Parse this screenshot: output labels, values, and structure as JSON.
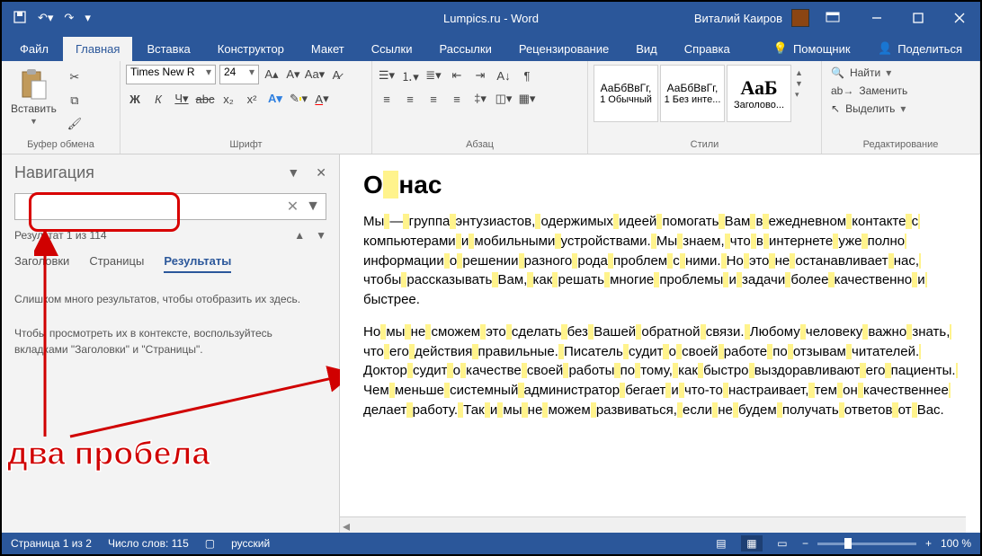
{
  "titlebar": {
    "title": "Lumpics.ru - Word",
    "user": "Виталий Каиров"
  },
  "tabs": {
    "items": [
      "Файл",
      "Главная",
      "Вставка",
      "Конструктор",
      "Макет",
      "Ссылки",
      "Рассылки",
      "Рецензирование",
      "Вид",
      "Справка"
    ],
    "active": 1,
    "assist": "Помощник",
    "share": "Поделиться"
  },
  "ribbon": {
    "clipboard": {
      "paste": "Вставить",
      "label": "Буфер обмена"
    },
    "font": {
      "name": "Times New R",
      "size": "24",
      "label": "Шрифт"
    },
    "paragraph": {
      "label": "Абзац"
    },
    "styles": {
      "label": "Стили",
      "items": [
        {
          "sample": "АаБбВвГг,",
          "name": "1 Обычный"
        },
        {
          "sample": "АаБбВвГг,",
          "name": "1 Без инте..."
        },
        {
          "sample": "АаБ",
          "name": "Заголово..."
        }
      ]
    },
    "editing": {
      "find": "Найти",
      "replace": "Заменить",
      "select": "Выделить",
      "label": "Редактирование"
    }
  },
  "nav": {
    "title": "Навигация",
    "result": "Результат 1 из 114",
    "tabs": {
      "headings": "Заголовки",
      "pages": "Страницы",
      "results": "Результаты"
    },
    "msg1": "Слишком много результатов, чтобы отобразить их здесь.",
    "msg2": "Чтобы просмотреть их в контексте, воспользуйтесь вкладками \"Заголовки\" и \"Страницы\"."
  },
  "annotation": {
    "text": "два пробела"
  },
  "doc": {
    "heading_pre": "О",
    "heading_post": "нас",
    "p1": "Мы — группа энтузиастов, одержимых идеей помогать Вам в ежедневном контакте с компьютерами и мобильными устройствами. Мы знаем, что в интернете уже полно информации о решении разного рода проблем с ними. Но это не останавливает нас, чтобы рассказывать Вам, как решать многие проблемы и задачи более качественно и быстрее.",
    "p2": "Но мы не сможем это сделать без Вашей обратной связи. Любому человеку важно знать, что его действия правильные. Писатель судит о своей работе по отзывам читателей. Доктор судит о качестве своей работы по тому, как быстро выздоравливают его пациенты. Чем меньше системный администратор бегает и что-то настраивает, тем он качественнее делает работу. Так и мы не можем развиваться, если не будем получать ответов от Вас."
  },
  "status": {
    "page": "Страница 1 из 2",
    "words": "Число слов: 115",
    "lang": "русский",
    "zoom": "100 %"
  }
}
